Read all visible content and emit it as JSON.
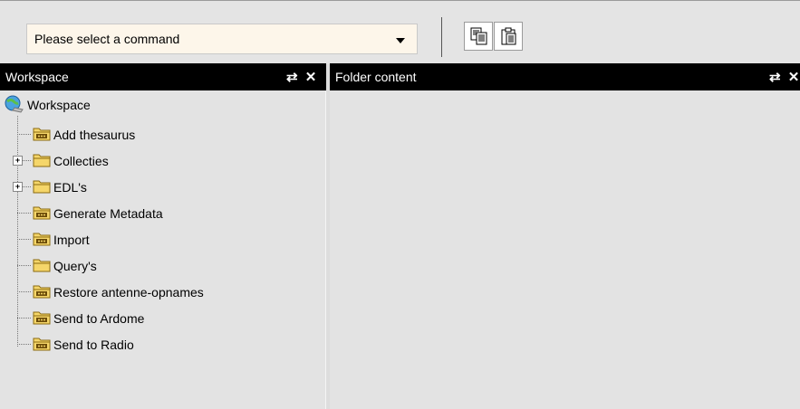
{
  "toolbar": {
    "command_select_value": "Please select a command",
    "copy_button": "copy-icon",
    "paste_button": "paste-icon"
  },
  "left_panel": {
    "title": "Workspace",
    "refresh_icon": "⇄",
    "close_icon": "✕"
  },
  "right_panel": {
    "title": "Folder content",
    "refresh_icon": "⇄",
    "close_icon": "✕"
  },
  "tree": {
    "root_label": "Workspace",
    "items": [
      {
        "label": "Add thesaurus",
        "icon": "action-folder-icon",
        "expandable": false
      },
      {
        "label": "Collecties",
        "icon": "folder-icon",
        "expandable": true
      },
      {
        "label": "EDL's",
        "icon": "folder-icon",
        "expandable": true
      },
      {
        "label": "Generate Metadata",
        "icon": "action-folder-icon",
        "expandable": false
      },
      {
        "label": "Import",
        "icon": "action-folder-icon",
        "expandable": false
      },
      {
        "label": "Query's",
        "icon": "folder-icon",
        "expandable": false
      },
      {
        "label": "Restore antenne-opnames",
        "icon": "action-folder-icon",
        "expandable": false
      },
      {
        "label": "Send to Ardome",
        "icon": "action-folder-icon",
        "expandable": false
      },
      {
        "label": "Send to Radio",
        "icon": "action-folder-icon",
        "expandable": false
      }
    ]
  },
  "colors": {
    "header_bg": "#000000",
    "panel_bg": "#e3e3e3",
    "select_bg": "#fdf6ea",
    "folder_yellow": "#f5d66a"
  }
}
